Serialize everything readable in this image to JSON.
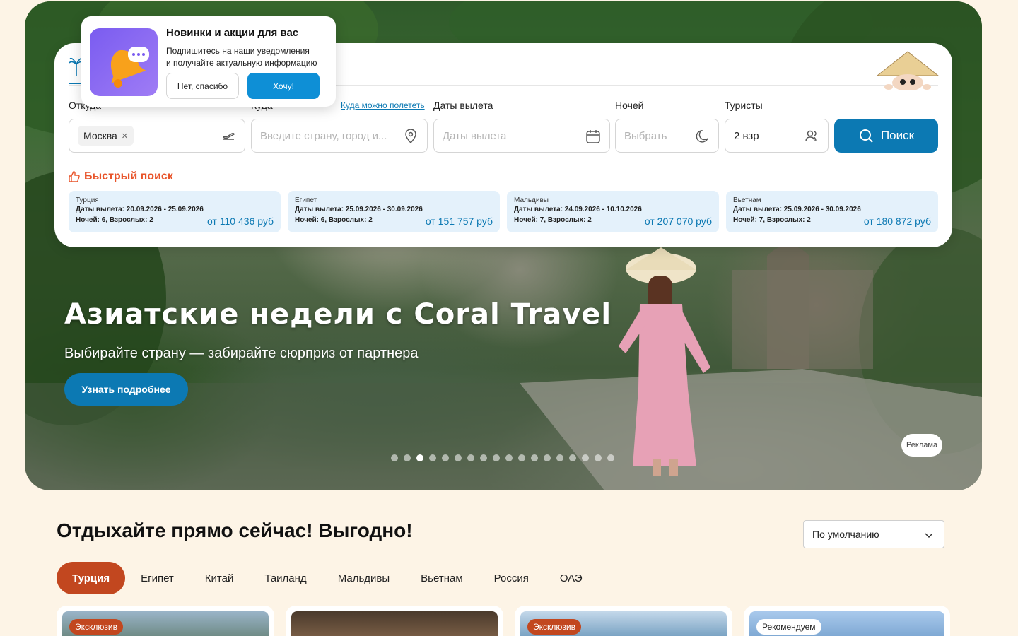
{
  "notification": {
    "title": "Новинки и акции для вас",
    "text_line1": "Подпишитесь на наши уведомления",
    "text_line2": "и получайте актуальную информацию",
    "decline_label": "Нет, спасибо",
    "accept_label": "Хочу!",
    "image_icon": "bell-icon"
  },
  "search": {
    "from_label": "Откуда",
    "to_label": "Куда",
    "where_link": "Куда можно полететь",
    "dates_label": "Даты вылета",
    "nights_label": "Ночей",
    "tourists_label": "Туристы",
    "from_value": "Москва",
    "to_placeholder": "Введите страну, город и...",
    "dates_placeholder": "Даты вылета",
    "nights_placeholder": "Выбрать",
    "tourists_value": "2 взр",
    "search_label": "Поиск"
  },
  "quick_search": {
    "title": "Быстрый поиск",
    "offers": [
      {
        "country": "Турция",
        "dates": "Даты вылета: 20.09.2026 - 25.09.2026",
        "details": "Ночей: 6, Взрослых: 2",
        "price": "от 110 436 руб"
      },
      {
        "country": "Египет",
        "dates": "Даты вылета: 25.09.2026 - 30.09.2026",
        "details": "Ночей: 6, Взрослых: 2",
        "price": "от 151 757 руб"
      },
      {
        "country": "Мальдивы",
        "dates": "Даты вылета: 24.09.2026 - 10.10.2026",
        "details": "Ночей: 7, Взрослых: 2",
        "price": "от 207 070 руб"
      },
      {
        "country": "Вьетнам",
        "dates": "Даты вылета: 25.09.2026 - 30.09.2026",
        "details": "Ночей: 7, Взрослых: 2",
        "price": "от 180 872 руб"
      }
    ]
  },
  "hero": {
    "title": "Азиатские недели с Coral Travel",
    "subtitle": "Выбирайте страну — забирайте сюрприз от партнера",
    "cta_label": "Узнать подробнее",
    "ad_label": "Реклама",
    "slides_count": 18,
    "active_slide": 3
  },
  "deals": {
    "title": "Отдыхайте прямо сейчас! Выгодно!",
    "sort_value": "По умолчанию",
    "tabs": [
      "Турция",
      "Египет",
      "Китай",
      "Таиланд",
      "Мальдивы",
      "Вьетнам",
      "Россия",
      "ОАЭ"
    ],
    "active_tab": 0,
    "cards": [
      {
        "tag": "Эксклюзив"
      },
      {
        "tag": ""
      },
      {
        "tag": "Эксклюзив"
      },
      {
        "tag": "Рекомендуем"
      }
    ]
  },
  "colors": {
    "primary": "#0c79b3",
    "accent": "#c2471f",
    "quick_title": "#e8542a",
    "card_bg": "#e4f1fb",
    "section_bg": "#fdf4e6"
  }
}
